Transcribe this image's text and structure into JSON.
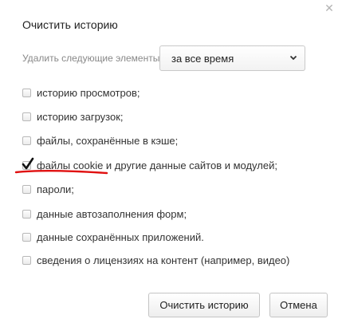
{
  "dialog": {
    "title": "Очистить историю",
    "close_icon": "close-icon"
  },
  "range": {
    "label": "Удалить следующие элементы:",
    "selected": "за все время"
  },
  "options": [
    {
      "label": "историю просмотров;",
      "checked": false
    },
    {
      "label": "историю загрузок;",
      "checked": false
    },
    {
      "label": "файлы, сохранённые в кэше;",
      "checked": false
    },
    {
      "label": "файлы cookie и другие данные сайтов и модулей;",
      "checked": true
    },
    {
      "label": "пароли;",
      "checked": false
    },
    {
      "label": "данные автозаполнения форм;",
      "checked": false
    },
    {
      "label": "данные сохранённых приложений.",
      "checked": false
    },
    {
      "label": "сведения о лицензиях на контент (например, видео)",
      "checked": false
    }
  ],
  "buttons": {
    "clear": "Очистить историю",
    "cancel": "Отмена"
  },
  "colors": {
    "annotation": "#e01010",
    "checkmark": "#111111"
  }
}
